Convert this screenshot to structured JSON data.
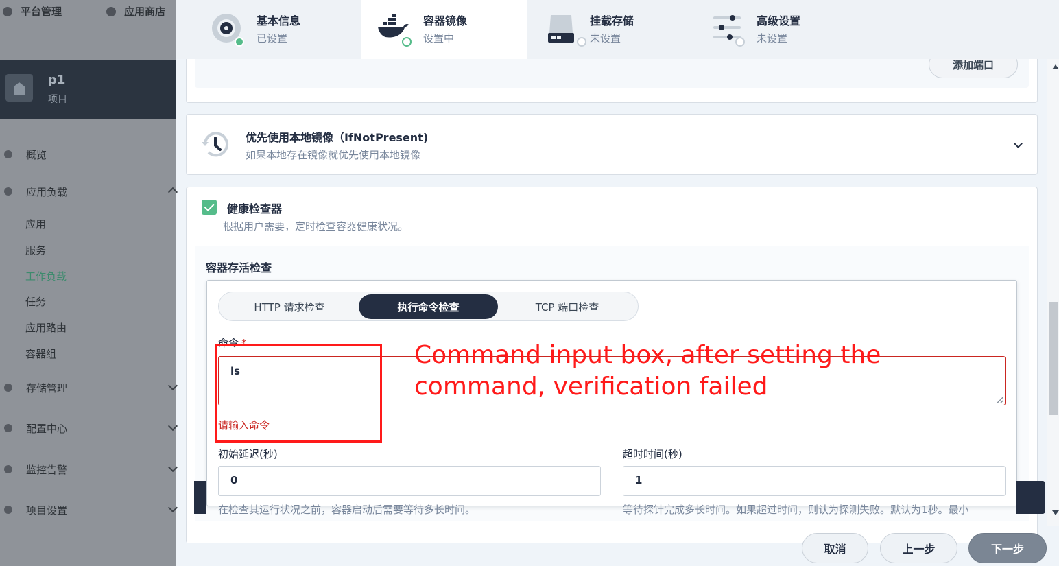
{
  "topnav": {
    "platform": "平台管理",
    "appstore": "应用商店"
  },
  "project": {
    "name": "p1",
    "label": "项目"
  },
  "sidebar": {
    "items": [
      {
        "label": "概览"
      },
      {
        "label": "应用负载"
      },
      {
        "label": "存储管理"
      },
      {
        "label": "配置中心"
      },
      {
        "label": "监控告警"
      },
      {
        "label": "项目设置"
      }
    ],
    "workload_sub": [
      "应用",
      "服务",
      "工作负载",
      "任务",
      "应用路由",
      "容器组"
    ],
    "active_sub": "工作负载"
  },
  "steps": [
    {
      "title": "基本信息",
      "status": "已设置",
      "icon": "settings-disc-icon"
    },
    {
      "title": "容器镜像",
      "status": "设置中",
      "icon": "docker-whale-icon"
    },
    {
      "title": "挂载存储",
      "status": "未设置",
      "icon": "storage-disk-icon"
    },
    {
      "title": "高级设置",
      "status": "未设置",
      "icon": "sliders-icon"
    }
  ],
  "ports": {
    "add_port_label": "添加端口"
  },
  "pull_policy": {
    "title": "优先使用本地镜像（IfNotPresent)",
    "desc": "如果本地存在镜像就优先使用本地镜像"
  },
  "health_check": {
    "title": "健康检查器",
    "desc": "根据用户需要，定时检查容器健康状况。",
    "checked": true,
    "liveness_title": "容器存活检查",
    "tabs": [
      "HTTP 请求检查",
      "执行命令检查",
      "TCP 端口检查"
    ],
    "active_tab": "执行命令检查",
    "command_label": "命令",
    "required_mark": "*",
    "command_value": "ls",
    "command_error": "请输入命令",
    "initial_delay_label": "初始延迟(秒)",
    "initial_delay_value": "0",
    "initial_delay_hint": "在检查其运行状况之前，容器启动后需要等待多长时间。",
    "timeout_label": "超时时间(秒)",
    "timeout_value": "1",
    "timeout_hint": "等待探针完成多长时间。如果超过时间，则认为探测失败。默认为1秒。最小"
  },
  "footer": {
    "cancel": "取消",
    "prev": "上一步",
    "next": "下一步"
  },
  "annotation": {
    "text": "Command input box, after setting the command, verification failed"
  },
  "colors": {
    "accent_green": "#55bc8a",
    "error_red": "#ca2621",
    "annotation_red": "#ff1a1a",
    "dark": "#242e42"
  }
}
